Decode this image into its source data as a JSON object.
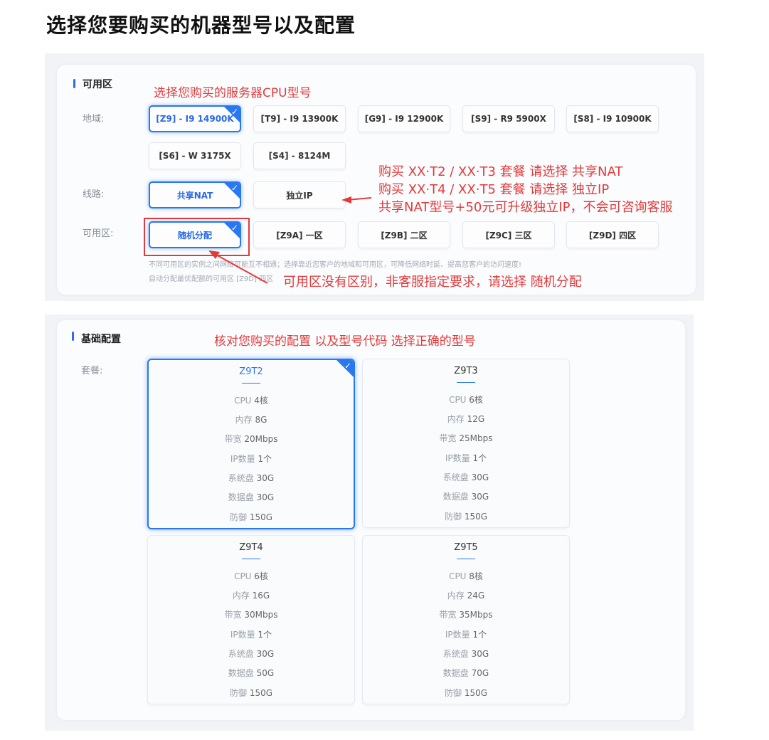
{
  "page_title": "选择您要购买的机器型号以及配置",
  "zone_section": {
    "title": "可用区",
    "labels": {
      "region": "地域:",
      "line": "线路:",
      "zone": "可用区:"
    },
    "regions": [
      "[Z9] - I9 14900K",
      "[T9] - I9 13900K",
      "[G9] - I9 12900K",
      "[S9] - R9 5900X",
      "[S8] - I9 10900K",
      "[S6] - W 3175X",
      "[S4] - 8124M"
    ],
    "lines": [
      "共享NAT",
      "独立IP"
    ],
    "zones": [
      "随机分配",
      "[Z9A] 一区",
      "[Z9B] 二区",
      "[Z9C] 三区",
      "[Z9D] 四区"
    ],
    "hint1": "不同可用区的实例之间网络可能互不相通；选择靠近您客户的地域和可用区，可降低网络时延、提高您客户的访问速度!",
    "hint2": "自动分配最优配额的可用区 [Z9D] 四区"
  },
  "annotations": {
    "a1": "选择您购买的服务器CPU型号",
    "a2": "购买  XX·T2 / XX·T3  套餐 请选择  共享NAT",
    "a3": "购买  XX·T4 / XX·T5  套餐 请选择  独立IP",
    "a4": "共享NAT型号+50元可升级独立IP，不会可咨询客服",
    "a5": "可用区没有区别，非客服指定要求，请选择  随机分配",
    "a6": "核对您购买的配置  以及型号代码  选择正确的型号"
  },
  "base_section": {
    "title": "基础配置",
    "label": "套餐:",
    "packages": [
      {
        "name": "Z9T2",
        "specs": [
          [
            "CPU",
            "4核"
          ],
          [
            "内存",
            "8G"
          ],
          [
            "带宽",
            "20Mbps"
          ],
          [
            "IP数量",
            "1个"
          ],
          [
            "系统盘",
            "30G"
          ],
          [
            "数据盘",
            "30G"
          ],
          [
            "防御",
            "150G"
          ]
        ]
      },
      {
        "name": "Z9T3",
        "specs": [
          [
            "CPU",
            "6核"
          ],
          [
            "内存",
            "12G"
          ],
          [
            "带宽",
            "25Mbps"
          ],
          [
            "IP数量",
            "1个"
          ],
          [
            "系统盘",
            "30G"
          ],
          [
            "数据盘",
            "30G"
          ],
          [
            "防御",
            "150G"
          ]
        ]
      },
      {
        "name": "Z9T4",
        "specs": [
          [
            "CPU",
            "6核"
          ],
          [
            "内存",
            "16G"
          ],
          [
            "带宽",
            "30Mbps"
          ],
          [
            "IP数量",
            "1个"
          ],
          [
            "系统盘",
            "30G"
          ],
          [
            "数据盘",
            "50G"
          ],
          [
            "防御",
            "150G"
          ]
        ]
      },
      {
        "name": "Z9T5",
        "specs": [
          [
            "CPU",
            "8核"
          ],
          [
            "内存",
            "24G"
          ],
          [
            "带宽",
            "35Mbps"
          ],
          [
            "IP数量",
            "1个"
          ],
          [
            "系统盘",
            "30G"
          ],
          [
            "数据盘",
            "70G"
          ],
          [
            "防御",
            "150G"
          ]
        ]
      }
    ]
  },
  "colors": {
    "accent": "#2a78f0",
    "annotation": "#e23a3a"
  },
  "icons": {
    "check": "check-icon"
  }
}
